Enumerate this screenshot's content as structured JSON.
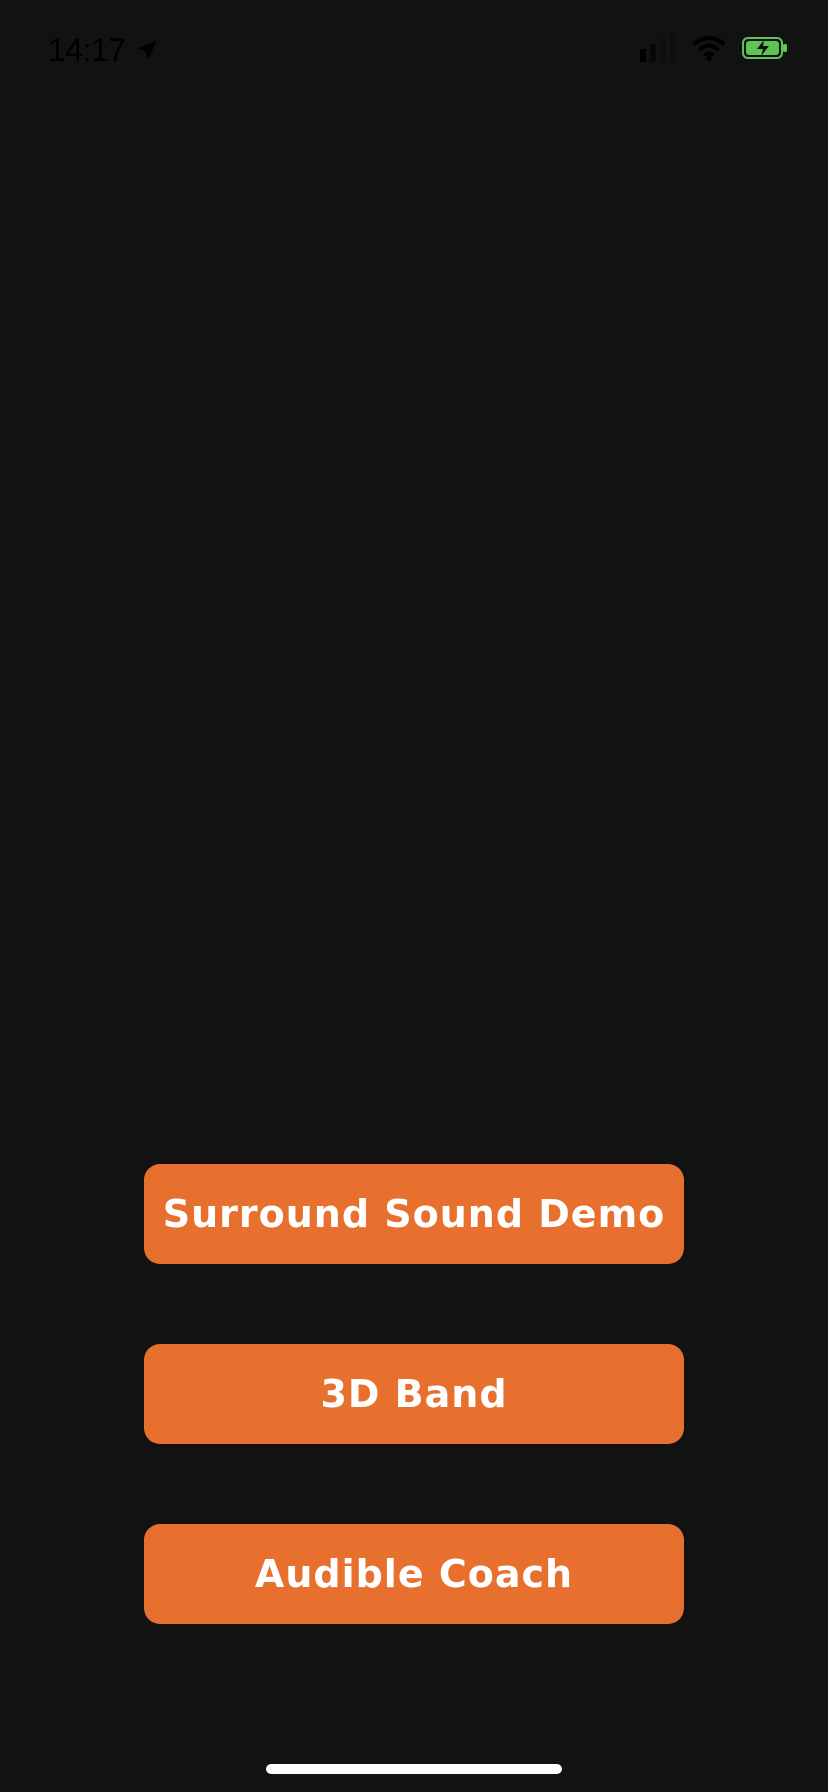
{
  "status_bar": {
    "time": "14:17",
    "location_icon": "location-arrow-icon",
    "signal_icon": "signal-strength-icon",
    "wifi_icon": "wifi-icon",
    "battery_icon": "battery-charging-icon"
  },
  "buttons": [
    {
      "label": "Surround Sound Demo"
    },
    {
      "label": "3D Band"
    },
    {
      "label": "Audible Coach"
    }
  ],
  "colors": {
    "background": "#121212",
    "button": "#e8702e",
    "button_text": "#ffffff",
    "home_indicator": "#ffffff",
    "battery": "#5fc356"
  }
}
